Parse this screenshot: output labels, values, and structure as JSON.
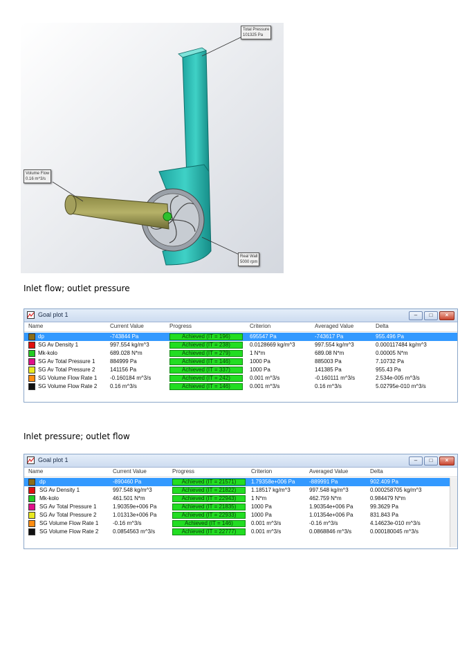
{
  "figure": {
    "callout_top": [
      "Total Pressure",
      "101325 Pa"
    ],
    "callout_left": [
      "Volume Flow",
      "0.16 m^3/s"
    ],
    "callout_bottom": [
      "Real Wall",
      "5000 rpm"
    ]
  },
  "captions": {
    "first": "Inlet flow; outlet pressure",
    "second": "Inlet pressure; outlet flow"
  },
  "plot1": {
    "title": "Goal plot 1",
    "columns": [
      "Name",
      "Current Value",
      "Progress",
      "Criterion",
      "Averaged Value",
      "Delta"
    ],
    "rows": [
      {
        "color": "#8b6d1a",
        "name": "dp",
        "current": "-743844 Pa",
        "progress": "Achieved (IT = 196)",
        "criterion": "695547 Pa",
        "averaged": "-743617 Pa",
        "delta": "955.496 Pa"
      },
      {
        "color": "#e01010",
        "name": "SG Av Density 1",
        "current": "997.554 kg/m^3",
        "progress": "Achieved (IT = 238)",
        "criterion": "0.0128669 kg/m^3",
        "averaged": "997.554 kg/m^3",
        "delta": "0.000117484 kg/m^3"
      },
      {
        "color": "#22cc22",
        "name": "Mk-kolo",
        "current": "689.028 N*m",
        "progress": "Achieved (IT = 279)",
        "criterion": "1 N*m",
        "averaged": "689.08 N*m",
        "delta": "0.00005 N*m"
      },
      {
        "color": "#e0108a",
        "name": "SG Av Total Pressure 1",
        "current": "884999 Pa",
        "progress": "Achieved (IT = 146)",
        "criterion": "1000 Pa",
        "averaged": "885003 Pa",
        "delta": "7.10732 Pa"
      },
      {
        "color": "#e8e820",
        "name": "SG Av Total Pressure 2",
        "current": "141156 Pa",
        "progress": "Achieved (IT = 337)",
        "criterion": "1000 Pa",
        "averaged": "141385 Pa",
        "delta": "955.43 Pa"
      },
      {
        "color": "#ff8c10",
        "name": "SG Volume Flow Rate 1",
        "current": "-0.160184 m^3/s",
        "progress": "Achieved (IT = 242)",
        "criterion": "0.001 m^3/s",
        "averaged": "-0.160111 m^3/s",
        "delta": "2.534e-005 m^3/s"
      },
      {
        "color": "#111111",
        "name": "SG Volume Flow Rate 2",
        "current": "0.16 m^3/s",
        "progress": "Achieved (IT = 146)",
        "criterion": "0.001 m^3/s",
        "averaged": "0.16 m^3/s",
        "delta": "5.02795e-010 m^3/s"
      }
    ]
  },
  "plot2": {
    "title": "Goal plot 1",
    "columns": [
      "Name",
      "Current Value",
      "Progress",
      "Criterion",
      "Averaged Value",
      "Delta"
    ],
    "rows": [
      {
        "color": "#8b6d1a",
        "name": "dp",
        "current": "-890460 Pa",
        "progress": "Achieved (IT = 21571)",
        "criterion": "1.79358e+006 Pa",
        "averaged": "-889991 Pa",
        "delta": "902.409 Pa"
      },
      {
        "color": "#e01010",
        "name": "SG Av Density 1",
        "current": "997.548 kg/m^3",
        "progress": "Achieved (IT = 21822)",
        "criterion": "1.18517 kg/m^3",
        "averaged": "997.548 kg/m^3",
        "delta": "0.000258705 kg/m^3"
      },
      {
        "color": "#22cc22",
        "name": "Mk-kolo",
        "current": "461.501 N*m",
        "progress": "Achieved (IT = 22943)",
        "criterion": "1 N*m",
        "averaged": "462.759 N*m",
        "delta": "0.984479 N*m"
      },
      {
        "color": "#e0108a",
        "name": "SG Av Total Pressure 1",
        "current": "1.90359e+006 Pa",
        "progress": "Achieved (IT = 21835)",
        "criterion": "1000 Pa",
        "averaged": "1.90354e+006 Pa",
        "delta": "99.3629 Pa"
      },
      {
        "color": "#e8e820",
        "name": "SG Av Total Pressure 2",
        "current": "1.01313e+006 Pa",
        "progress": "Achieved (IT = 22933)",
        "criterion": "1000 Pa",
        "averaged": "1.01354e+006 Pa",
        "delta": "831.843 Pa"
      },
      {
        "color": "#ff8c10",
        "name": "SG Volume Flow Rate 1",
        "current": "-0.16 m^3/s",
        "progress": "Achieved (IT = 146)",
        "criterion": "0.001 m^3/s",
        "averaged": "-0.16 m^3/s",
        "delta": "4.14623e-010 m^3/s"
      },
      {
        "color": "#111111",
        "name": "SG Volume Flow Rate 2",
        "current": "0.0854563 m^3/s",
        "progress": "Achieved (IT = 22777)",
        "criterion": "0.001 m^3/s",
        "averaged": "0.0868846 m^3/s",
        "delta": "0.000180045 m^3/s"
      }
    ]
  }
}
